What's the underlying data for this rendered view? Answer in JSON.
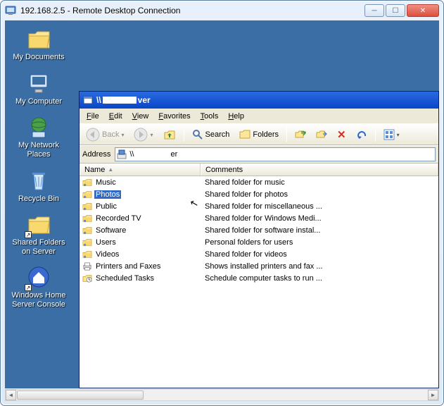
{
  "outer": {
    "title": "192.168.2.5 - Remote Desktop Connection"
  },
  "desktop": [
    {
      "label": "My Documents",
      "icon": "folder"
    },
    {
      "label": "My Computer",
      "icon": "computer"
    },
    {
      "label": "My Network Places",
      "icon": "network"
    },
    {
      "label": "Recycle Bin",
      "icon": "recycle"
    },
    {
      "label": "Shared Folders on Server",
      "icon": "folder-shortcut"
    },
    {
      "label": "Windows Home Server Console",
      "icon": "home-shortcut"
    }
  ],
  "explorer": {
    "titlePrefix": "\\\\",
    "titleSuffix": "ver",
    "menu": [
      "File",
      "Edit",
      "View",
      "Favorites",
      "Tools",
      "Help"
    ],
    "toolbar": {
      "back": "Back",
      "search": "Search",
      "folders": "Folders"
    },
    "address": {
      "label": "Address",
      "valuePrefix": "\\\\",
      "valueSuffix": "er"
    },
    "columns": {
      "name": "Name",
      "comments": "Comments"
    },
    "rows": [
      {
        "name": "Music",
        "comments": "Shared folder for music",
        "icon": "share",
        "sel": false
      },
      {
        "name": "Photos",
        "comments": "Shared folder for photos",
        "icon": "share",
        "sel": true
      },
      {
        "name": "Public",
        "comments": "Shared folder for miscellaneous ...",
        "icon": "share",
        "sel": false
      },
      {
        "name": "Recorded TV",
        "comments": "Shared folder for Windows Medi...",
        "icon": "share",
        "sel": false
      },
      {
        "name": "Software",
        "comments": "Shared folder for software instal...",
        "icon": "share",
        "sel": false
      },
      {
        "name": "Users",
        "comments": "Personal folders for users",
        "icon": "share",
        "sel": false
      },
      {
        "name": "Videos",
        "comments": "Shared folder for videos",
        "icon": "share",
        "sel": false
      },
      {
        "name": "Printers and Faxes",
        "comments": "Shows installed printers and fax ...",
        "icon": "printer",
        "sel": false
      },
      {
        "name": "Scheduled Tasks",
        "comments": "Schedule computer tasks to run ...",
        "icon": "tasks",
        "sel": false
      }
    ]
  }
}
